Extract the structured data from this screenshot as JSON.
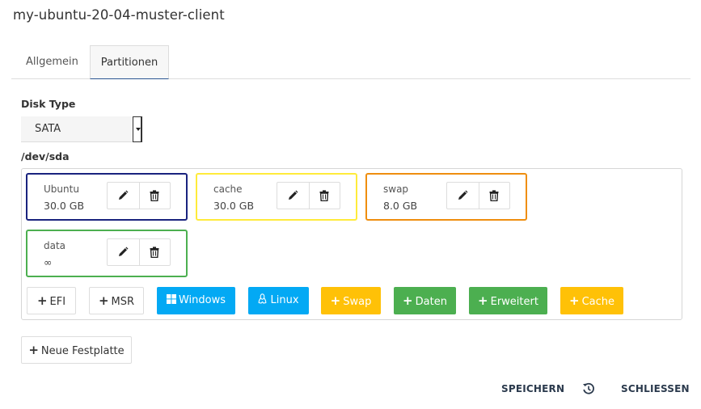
{
  "window": {
    "title": "my-ubuntu-20-04-muster-client"
  },
  "tabs": [
    {
      "label": "Allgemein",
      "active": false
    },
    {
      "label": "Partitionen",
      "active": true
    }
  ],
  "disk_type": {
    "label": "Disk Type",
    "value": "SATA"
  },
  "device": {
    "name": "/dev/sda",
    "partitions": [
      {
        "name": "Ubuntu",
        "size": "30.0 GB",
        "color": "#1a237e"
      },
      {
        "name": "cache",
        "size": "30.0 GB",
        "color": "#ffeb3b"
      },
      {
        "name": "swap",
        "size": "8.0 GB",
        "color": "#ef8e0f"
      },
      {
        "name": "data",
        "size": "∞",
        "color": "#4caf50"
      }
    ],
    "add_buttons": [
      {
        "label": "EFI",
        "icon": "plus-icon"
      },
      {
        "label": "MSR",
        "icon": "plus-icon"
      },
      {
        "label": "Windows",
        "icon": "windows-icon",
        "color": "#03a9f4"
      },
      {
        "label": "Linux",
        "icon": "linux-icon",
        "color": "#03a9f4"
      },
      {
        "label": "Swap",
        "icon": "plus-icon",
        "color": "#ffc107"
      },
      {
        "label": "Daten",
        "icon": "plus-icon",
        "color": "#4caf50"
      },
      {
        "label": "Erweitert",
        "icon": "plus-icon",
        "color": "#4caf50"
      },
      {
        "label": "Cache",
        "icon": "plus-icon",
        "color": "#ffc107"
      }
    ]
  },
  "new_disk": {
    "label": "Neue Festplatte"
  },
  "footer": {
    "save": "SPEICHERN",
    "close": "SCHLIESSEN",
    "history_icon": "history-icon"
  }
}
